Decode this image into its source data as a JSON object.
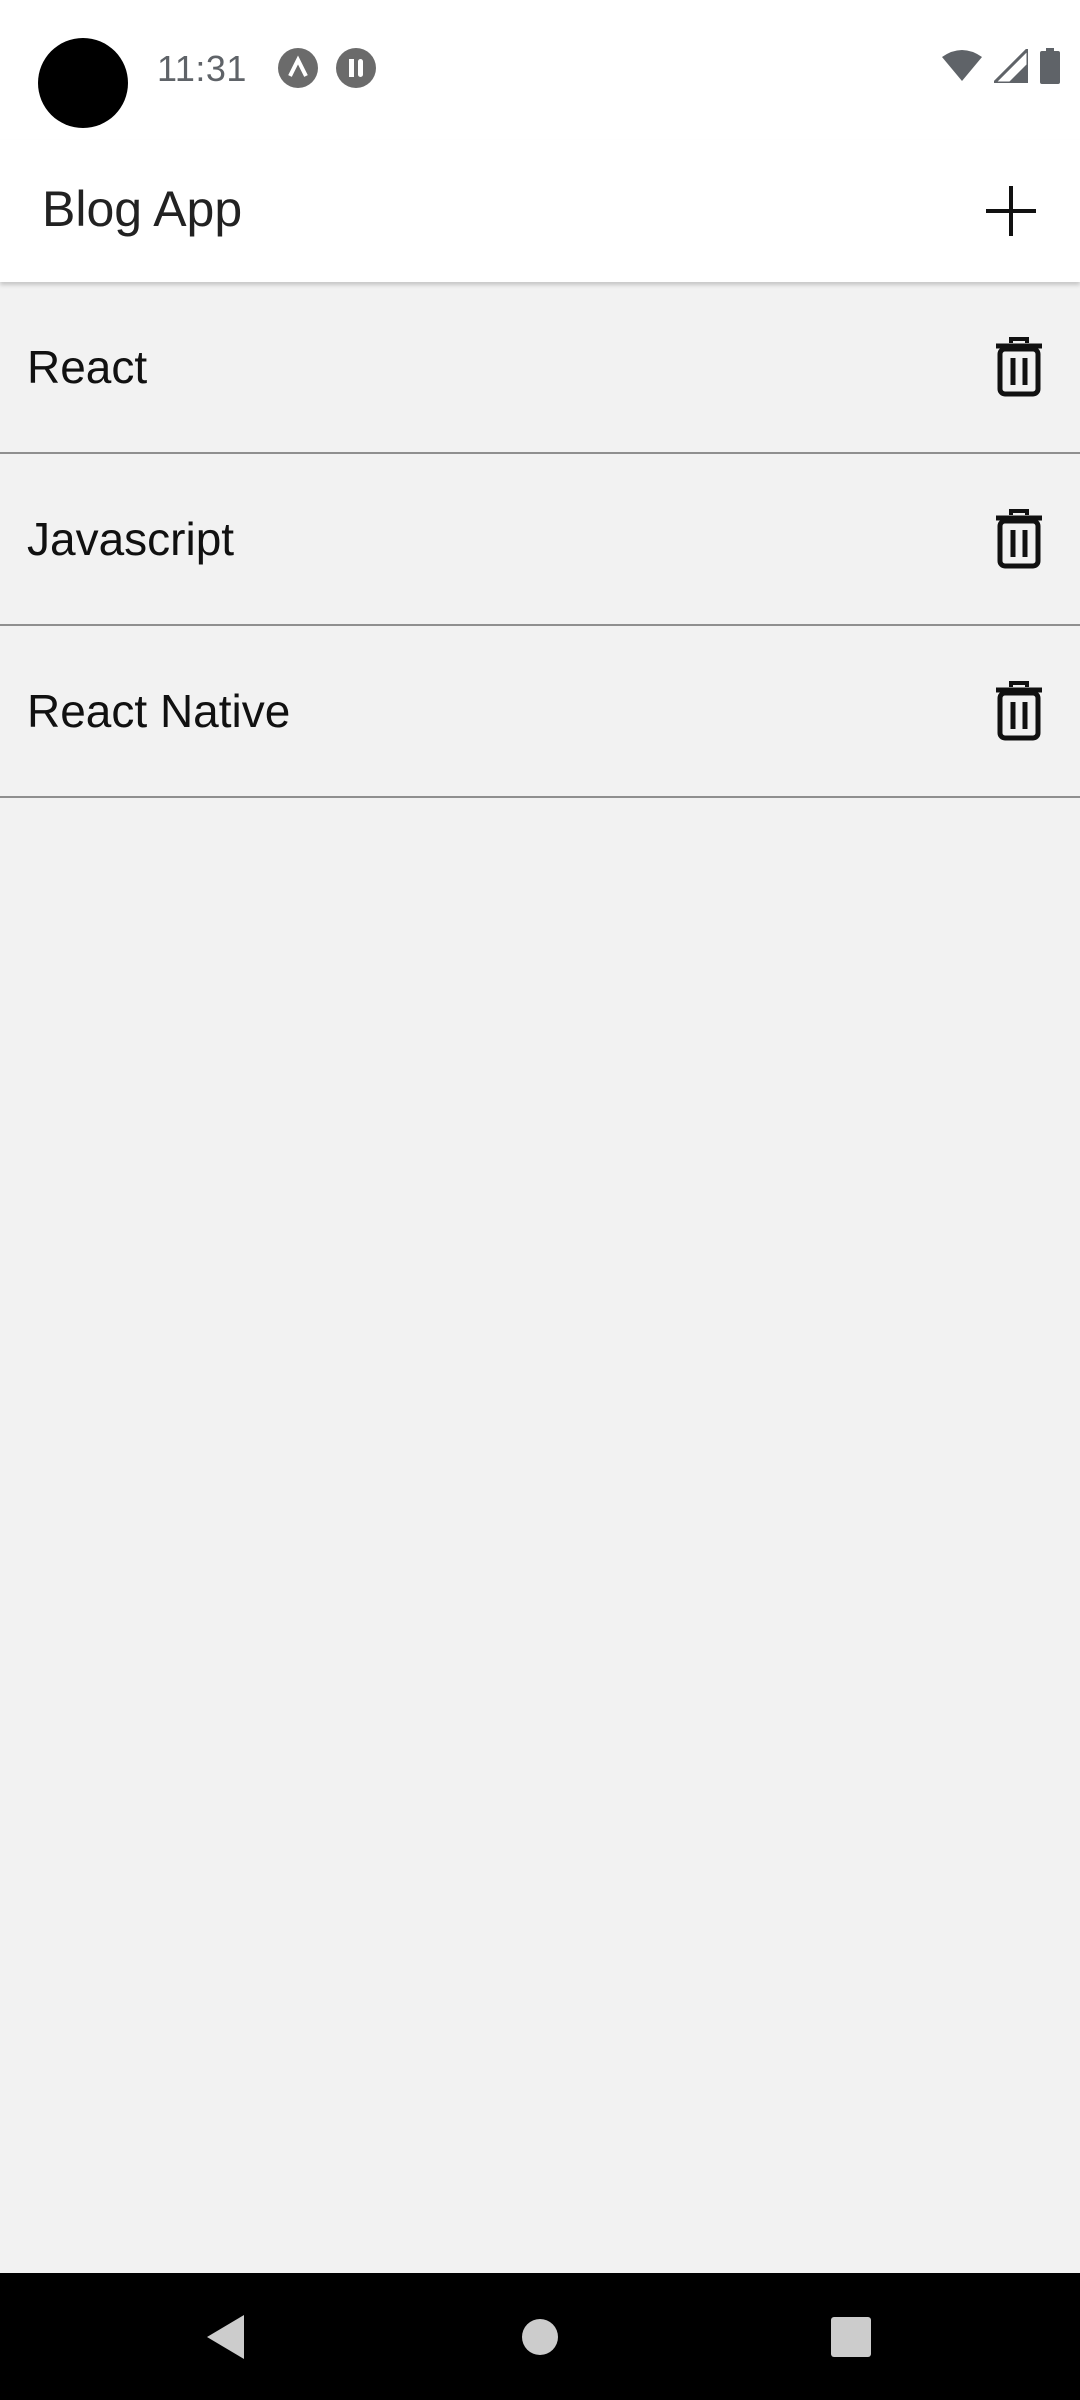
{
  "status_bar": {
    "time": "11:31",
    "icons": [
      "notification-a-icon",
      "notification-pause-icon",
      "wifi-icon",
      "signal-icon",
      "battery-icon"
    ]
  },
  "header": {
    "title": "Blog App",
    "add_icon": "plus-icon"
  },
  "posts": [
    {
      "title": "React",
      "action_icon": "trash-icon"
    },
    {
      "title": "Javascript",
      "action_icon": "trash-icon"
    },
    {
      "title": "React Native",
      "action_icon": "trash-icon"
    }
  ],
  "nav_bar": {
    "icons": [
      "back-icon",
      "home-icon",
      "recents-icon"
    ]
  },
  "colors": {
    "background": "#f2f2f2",
    "header": "#ffffff",
    "divider": "#8f8f8f",
    "nav": "#000000"
  }
}
